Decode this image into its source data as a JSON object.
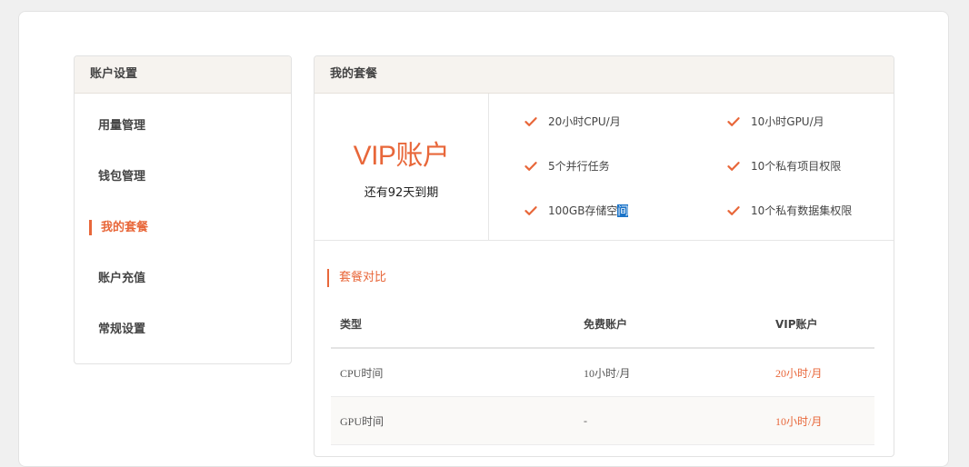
{
  "sidebar": {
    "header": "账户设置",
    "items": [
      {
        "label": "用量管理",
        "active": false
      },
      {
        "label": "钱包管理",
        "active": false
      },
      {
        "label": "我的套餐",
        "active": true
      },
      {
        "label": "账户充值",
        "active": false
      },
      {
        "label": "常规设置",
        "active": false
      }
    ]
  },
  "main": {
    "header": "我的套餐",
    "plan": {
      "name": "VIP账户",
      "expire_text": "还有92天到期"
    },
    "features": [
      {
        "text": "20小时CPU/月"
      },
      {
        "text": "10小时GPU/月"
      },
      {
        "text": "5个并行任务"
      },
      {
        "text": "10个私有项目权限"
      },
      {
        "text_before_selection": "100GB存储空",
        "text_selected": "间"
      },
      {
        "text": "10个私有数据集权限"
      }
    ],
    "compare": {
      "title": "套餐对比",
      "headers": [
        "类型",
        "免费账户",
        "VIP账户"
      ],
      "rows": [
        [
          "CPU时间",
          "10小时/月",
          "20小时/月"
        ],
        [
          "GPU时间",
          "-",
          "10小时/月"
        ]
      ]
    }
  },
  "colors": {
    "accent": "#e8673a",
    "header_bg": "#f6f3ef",
    "selection": "#1a73c8"
  },
  "icons": {
    "feature_check": "check-icon"
  }
}
